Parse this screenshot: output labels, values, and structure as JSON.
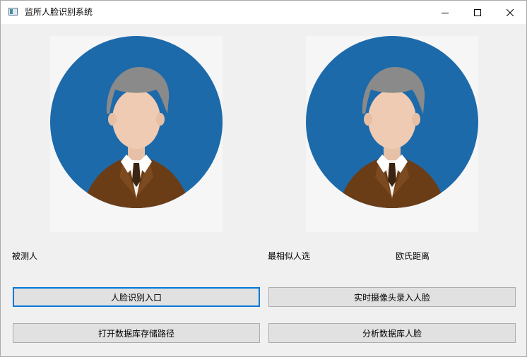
{
  "window": {
    "title": "监所人脸识别系统",
    "icons": {
      "app": "app-window-icon",
      "minimize": "minimize-icon",
      "maximize": "maximize-icon",
      "close": "close-icon"
    }
  },
  "photos": {
    "left": {
      "icon": "default-person-avatar"
    },
    "right": {
      "icon": "default-person-avatar"
    }
  },
  "labels": {
    "tested_person": "被测人",
    "most_similar": "最相似人选",
    "euclidean_distance": "欧氏距离"
  },
  "buttons": {
    "face_recognition_entry": "人脸识别入口",
    "realtime_camera_enroll": "实时摄像头录入人脸",
    "open_database_path": "打开数据库存储路径",
    "analyze_database_faces": "分析数据库人脸"
  },
  "colors": {
    "avatar_background": "#1d6aab",
    "button_focus_border": "#0078d7",
    "window_background": "#f0f0f0"
  }
}
